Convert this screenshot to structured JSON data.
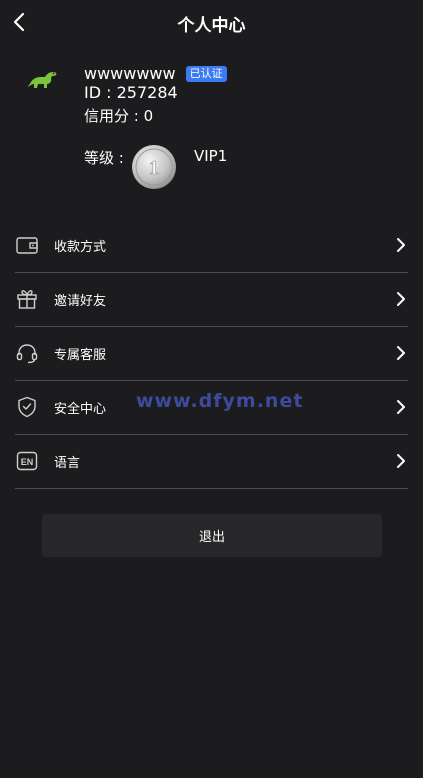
{
  "header": {
    "title": "个人中心",
    "back_icon": "chevron-left-icon"
  },
  "profile": {
    "avatar_icon": "dinosaur-icon",
    "username": "wwwwwww",
    "verified_badge": "已认证",
    "id_text": "ID : 257284",
    "credit_text": "信用分 : 0",
    "level_label": "等级 :",
    "level_medal_number": "1",
    "vip_text": "VIP1"
  },
  "menu": {
    "items": [
      {
        "label": "收款方式",
        "icon": "wallet-icon"
      },
      {
        "label": "邀请好友",
        "icon": "gift-icon"
      },
      {
        "label": "专属客服",
        "icon": "headset-icon"
      },
      {
        "label": "安全中心",
        "icon": "shield-check-icon"
      },
      {
        "label": "语言",
        "icon": "language-en-icon"
      }
    ]
  },
  "watermark": "www.dfym.net",
  "logout_label": "退出",
  "colors": {
    "background": "#1c1c1e",
    "badge": "#3d7bf5",
    "avatar_green": "#7cc63b",
    "divider": "#4b4b4e",
    "watermark": "#3e4a9c",
    "button_bg": "#272729"
  }
}
